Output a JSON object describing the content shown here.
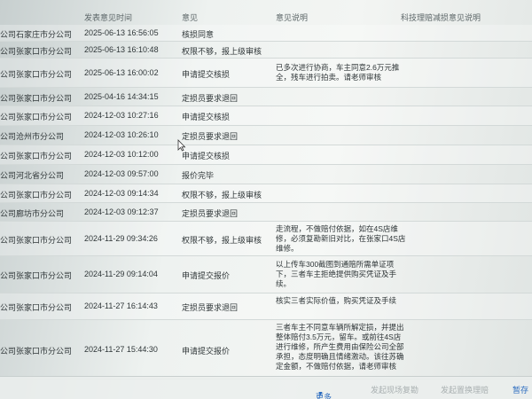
{
  "header": {
    "time_col": "发表意见时间",
    "opinion_col": "意见",
    "note_col": "意见说明",
    "dept_col": "科技理赔减损意见说明"
  },
  "rows": [
    {
      "org": "公司石家庄市分公司",
      "time": "2025-06-13 16:56:05",
      "op": "核损同意",
      "note": ""
    },
    {
      "org": "公司张家口市分公司",
      "time": "2025-06-13 16:10:48",
      "op": "权限不够，报上级审核",
      "note": ""
    },
    {
      "org": "公司张家口市分公司",
      "time": "2025-06-13 16:00:02",
      "op": "申请提交核损",
      "note": "已多次进行协商，车主同意2.6万元推全，残车进行拍卖。请老师审核"
    },
    {
      "org": "公司张家口市分公司",
      "time": "2025-04-16 14:34:15",
      "op": "定损员要求退回",
      "note": ""
    },
    {
      "org": "公司张家口市分公司",
      "time": "2024-12-03 10:27:16",
      "op": "申请提交核损",
      "note": ""
    },
    {
      "org": "公司沧州市分公司",
      "time": "2024-12-03 10:26:10",
      "op": "定损员要求退回",
      "note": ""
    },
    {
      "org": "公司张家口市分公司",
      "time": "2024-12-03 10:12:00",
      "op": "申请提交核损",
      "note": ""
    },
    {
      "org": "公司河北省分公司",
      "time": "2024-12-03 09:57:00",
      "op": "报价完毕",
      "note": ""
    },
    {
      "org": "公司张家口市分公司",
      "time": "2024-12-03 09:14:34",
      "op": "权限不够，报上级审核",
      "note": ""
    },
    {
      "org": "公司廊坊市分公司",
      "time": "2024-12-03 09:12:37",
      "op": "定损员要求退回",
      "note": ""
    },
    {
      "org": "公司张家口市分公司",
      "time": "2024-11-29 09:34:26",
      "op": "权限不够，报上级审核",
      "note": "走流程，不做赔付依据，如在4S店维修，必须复勘新旧对比，在张家口4S店维修。"
    },
    {
      "org": "公司张家口市分公司",
      "time": "2024-11-29 09:14:04",
      "op": "申请提交报价",
      "note": "以上传车300截图到通赔所需单证项下，三者车主拒绝提供购买凭证及手续。"
    },
    {
      "org": "公司张家口市分公司",
      "time": "2024-11-27 16:14:43",
      "op": "定损员要求退回",
      "note": "核实三者实际价值，购买凭证及手续"
    },
    {
      "org": "公司张家口市分公司",
      "time": "2024-11-27 15:44:30",
      "op": "申请提交报价",
      "note": "三者车主不同意车辆所解定损，并提出整体赔付3.5万元，留车。或前往4S店进行维修，所产生费用由保险公司全部承担，态度明确且情绪激动。该往苏确定金额，不做赔付依据，请老师审核"
    }
  ],
  "footer": {
    "more": "更多",
    "btn1": "发起现场复勘",
    "btn2": "发起置换理赔",
    "save": "暂存"
  }
}
